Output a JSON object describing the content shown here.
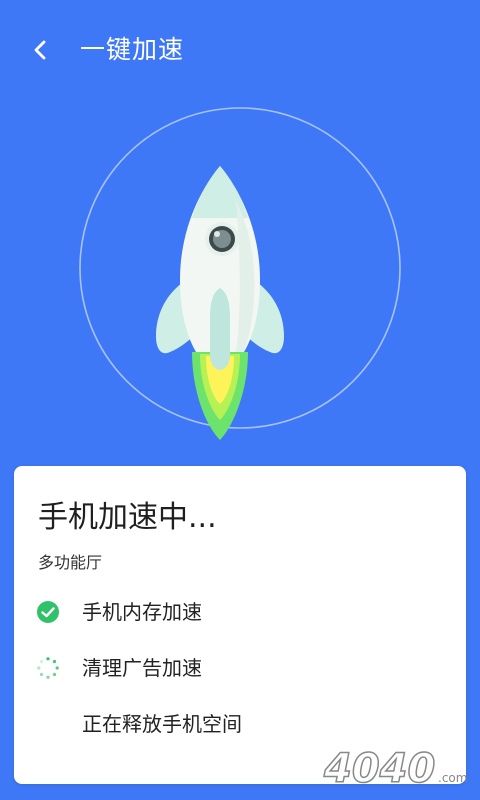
{
  "header": {
    "title": "一键加速"
  },
  "card": {
    "title": "手机加速中...",
    "subtitle": "多功能厅",
    "tasks": [
      {
        "label": "手机内存加速",
        "status": "done"
      },
      {
        "label": "清理广告加速",
        "status": "loading"
      },
      {
        "label": "正在释放手机空间",
        "status": "pending"
      }
    ]
  },
  "watermark": {
    "text": "4040",
    "suffix": ".com"
  },
  "colors": {
    "background": "#3f78f6",
    "card": "#ffffff",
    "accent_green": "#2fc26b",
    "rocket_body": "#f3f7f4",
    "rocket_fin": "#cfeee5",
    "flame_outer": "#6be36c",
    "flame_inner": "#fff35a"
  },
  "icons": {
    "back": "chevron-left-icon",
    "done": "check-circle-icon",
    "loading": "spinner-icon",
    "hero": "rocket-icon"
  }
}
